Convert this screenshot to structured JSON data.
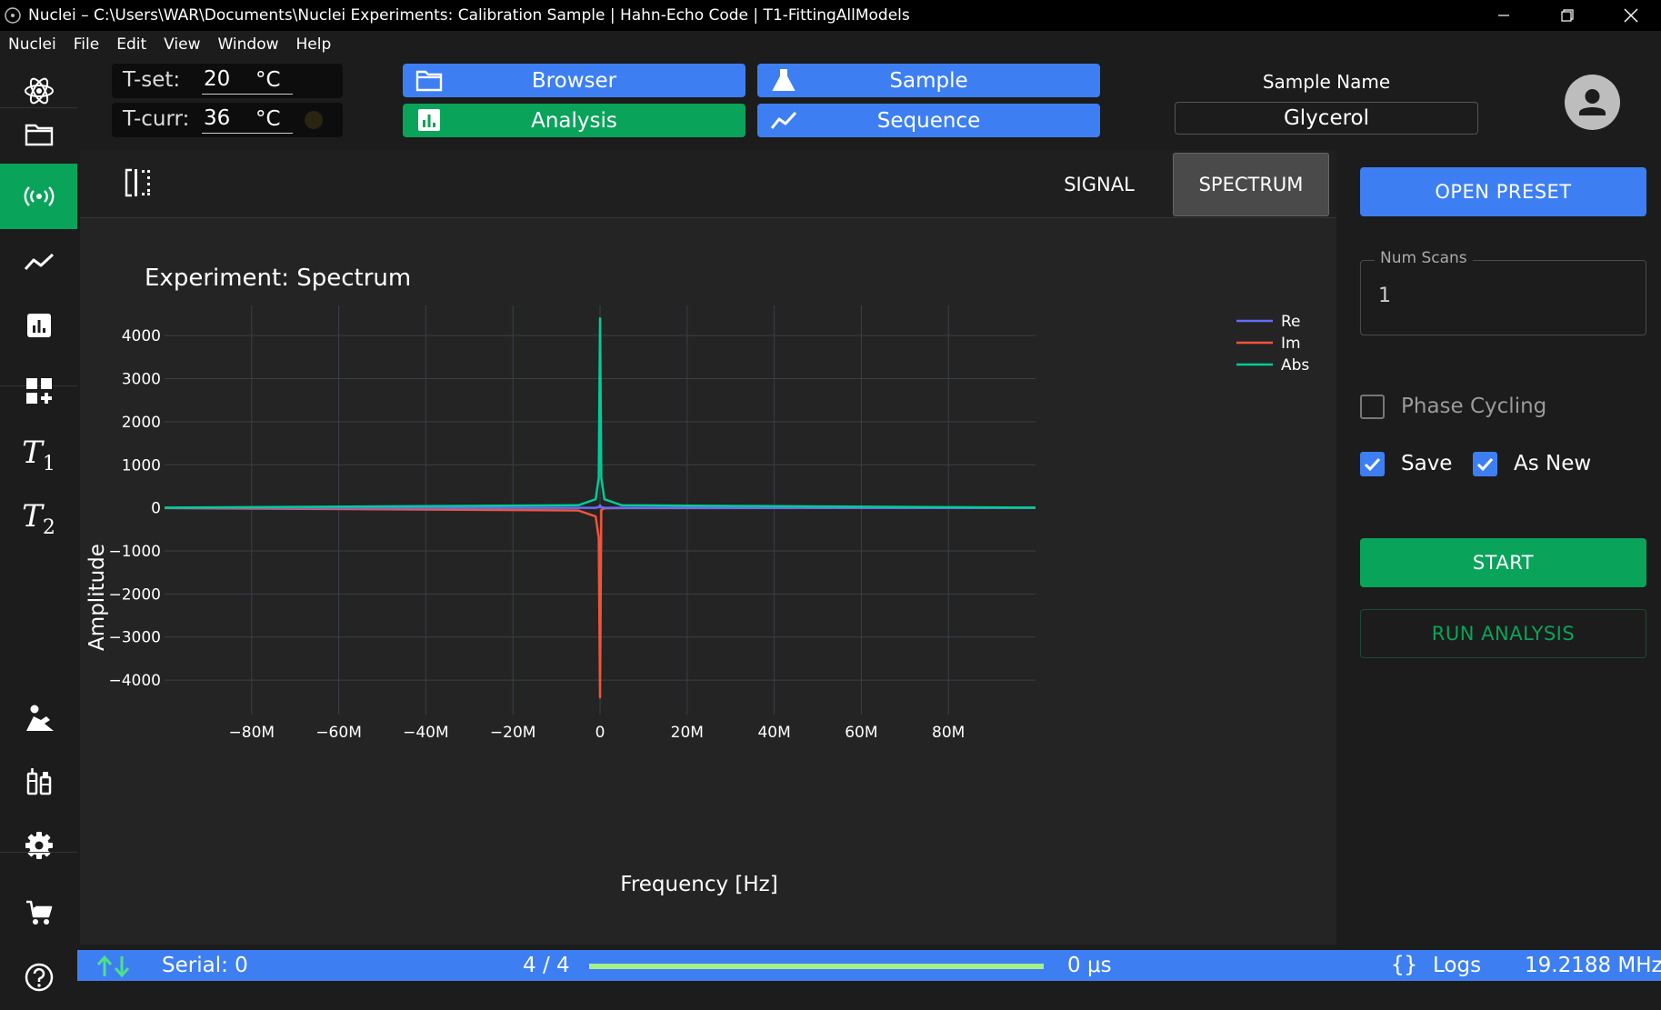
{
  "window": {
    "title": "Nuclei – C:\\Users\\WAR\\Documents\\Nuclei Experiments: Calibration Sample | Hahn-Echo Code | T1-FittingAllModels",
    "controls": [
      "minimize-icon",
      "restore-icon",
      "close-icon"
    ]
  },
  "menu": [
    "Nuclei",
    "File",
    "Edit",
    "View",
    "Window",
    "Help"
  ],
  "header": {
    "tset_label": "T-set:",
    "tset_value": "20",
    "tset_unit": "°C",
    "tcurr_label": "T-curr:",
    "tcurr_value": "36",
    "tcurr_unit": "°C",
    "buttons": {
      "browser": "Browser",
      "sample": "Sample",
      "analysis": "Analysis",
      "sequence": "Sequence"
    },
    "sample_name_label": "Sample Name",
    "sample_name_value": "Glycerol"
  },
  "sidebar": {
    "items": [
      "atom-icon",
      "folder-icon",
      "signal-icon",
      "line-chart-icon",
      "bar-chart-icon",
      "add-widget-icon",
      "t1-icon",
      "t2-icon",
      "person-icon",
      "syringe-icon",
      "settings-icon",
      "cart-icon",
      "help-icon"
    ],
    "t1_label": "T",
    "t1_sub": "1",
    "t2_label": "T",
    "t2_sub": "2"
  },
  "tabs": {
    "signal": "SIGNAL",
    "spectrum": "SPECTRUM",
    "active": "SPECTRUM"
  },
  "right_panel": {
    "open_preset": "OPEN PRESET",
    "num_scans_label": "Num Scans",
    "num_scans_value": "1",
    "phase_cycling_label": "Phase Cycling",
    "phase_cycling_checked": false,
    "save_label": "Save",
    "save_checked": true,
    "as_new_label": "As New",
    "as_new_checked": true,
    "start": "START",
    "run_analysis": "RUN ANALYSIS"
  },
  "status": {
    "serial": "Serial: 0",
    "progress_text": "4 / 4",
    "progress": 1.0,
    "time": "0 μs",
    "logs": "Logs",
    "frequency": "19.2188 MHz"
  },
  "colors": {
    "blue": "#3d7ff2",
    "green": "#0aa35a",
    "re": "#636efa",
    "im": "#ef553b",
    "abs": "#00cc96"
  },
  "chart_data": {
    "type": "line",
    "title": "Experiment: Spectrum",
    "xlabel": "Frequency [Hz]",
    "ylabel": "Amplitude",
    "xlim": [
      -100000000,
      100000000
    ],
    "ylim": [
      -4800,
      4700
    ],
    "x_ticks": [
      -80000000,
      -60000000,
      -40000000,
      -20000000,
      0,
      20000000,
      40000000,
      60000000,
      80000000
    ],
    "x_tick_labels": [
      "−80M",
      "−60M",
      "−40M",
      "−20M",
      "0",
      "20M",
      "40M",
      "60M",
      "80M"
    ],
    "y_ticks": [
      4000,
      3000,
      2000,
      1000,
      0,
      -1000,
      -2000,
      -3000,
      -4000
    ],
    "y_tick_labels": [
      "4000",
      "3000",
      "2000",
      "1000",
      "0",
      "−1000",
      "−2000",
      "−3000",
      "−4000"
    ],
    "grid": true,
    "legend": "top-right",
    "series": [
      {
        "name": "Re",
        "x": [
          -100000000,
          -1000000,
          -200000,
          0,
          200000,
          1000000,
          100000000
        ],
        "values": [
          0,
          0,
          20,
          60,
          20,
          0,
          0
        ]
      },
      {
        "name": "Im",
        "x": [
          -100000000,
          -5000000,
          -1000000,
          -300000,
          0,
          300000,
          1000000,
          5000000,
          100000000
        ],
        "values": [
          -5,
          -60,
          -200,
          -700,
          -4400,
          -50,
          -10,
          -5,
          0
        ]
      },
      {
        "name": "Abs",
        "x": [
          -100000000,
          -5000000,
          -1000000,
          -300000,
          0,
          300000,
          1000000,
          5000000,
          100000000
        ],
        "values": [
          5,
          60,
          200,
          700,
          4400,
          700,
          200,
          60,
          5
        ]
      }
    ]
  }
}
